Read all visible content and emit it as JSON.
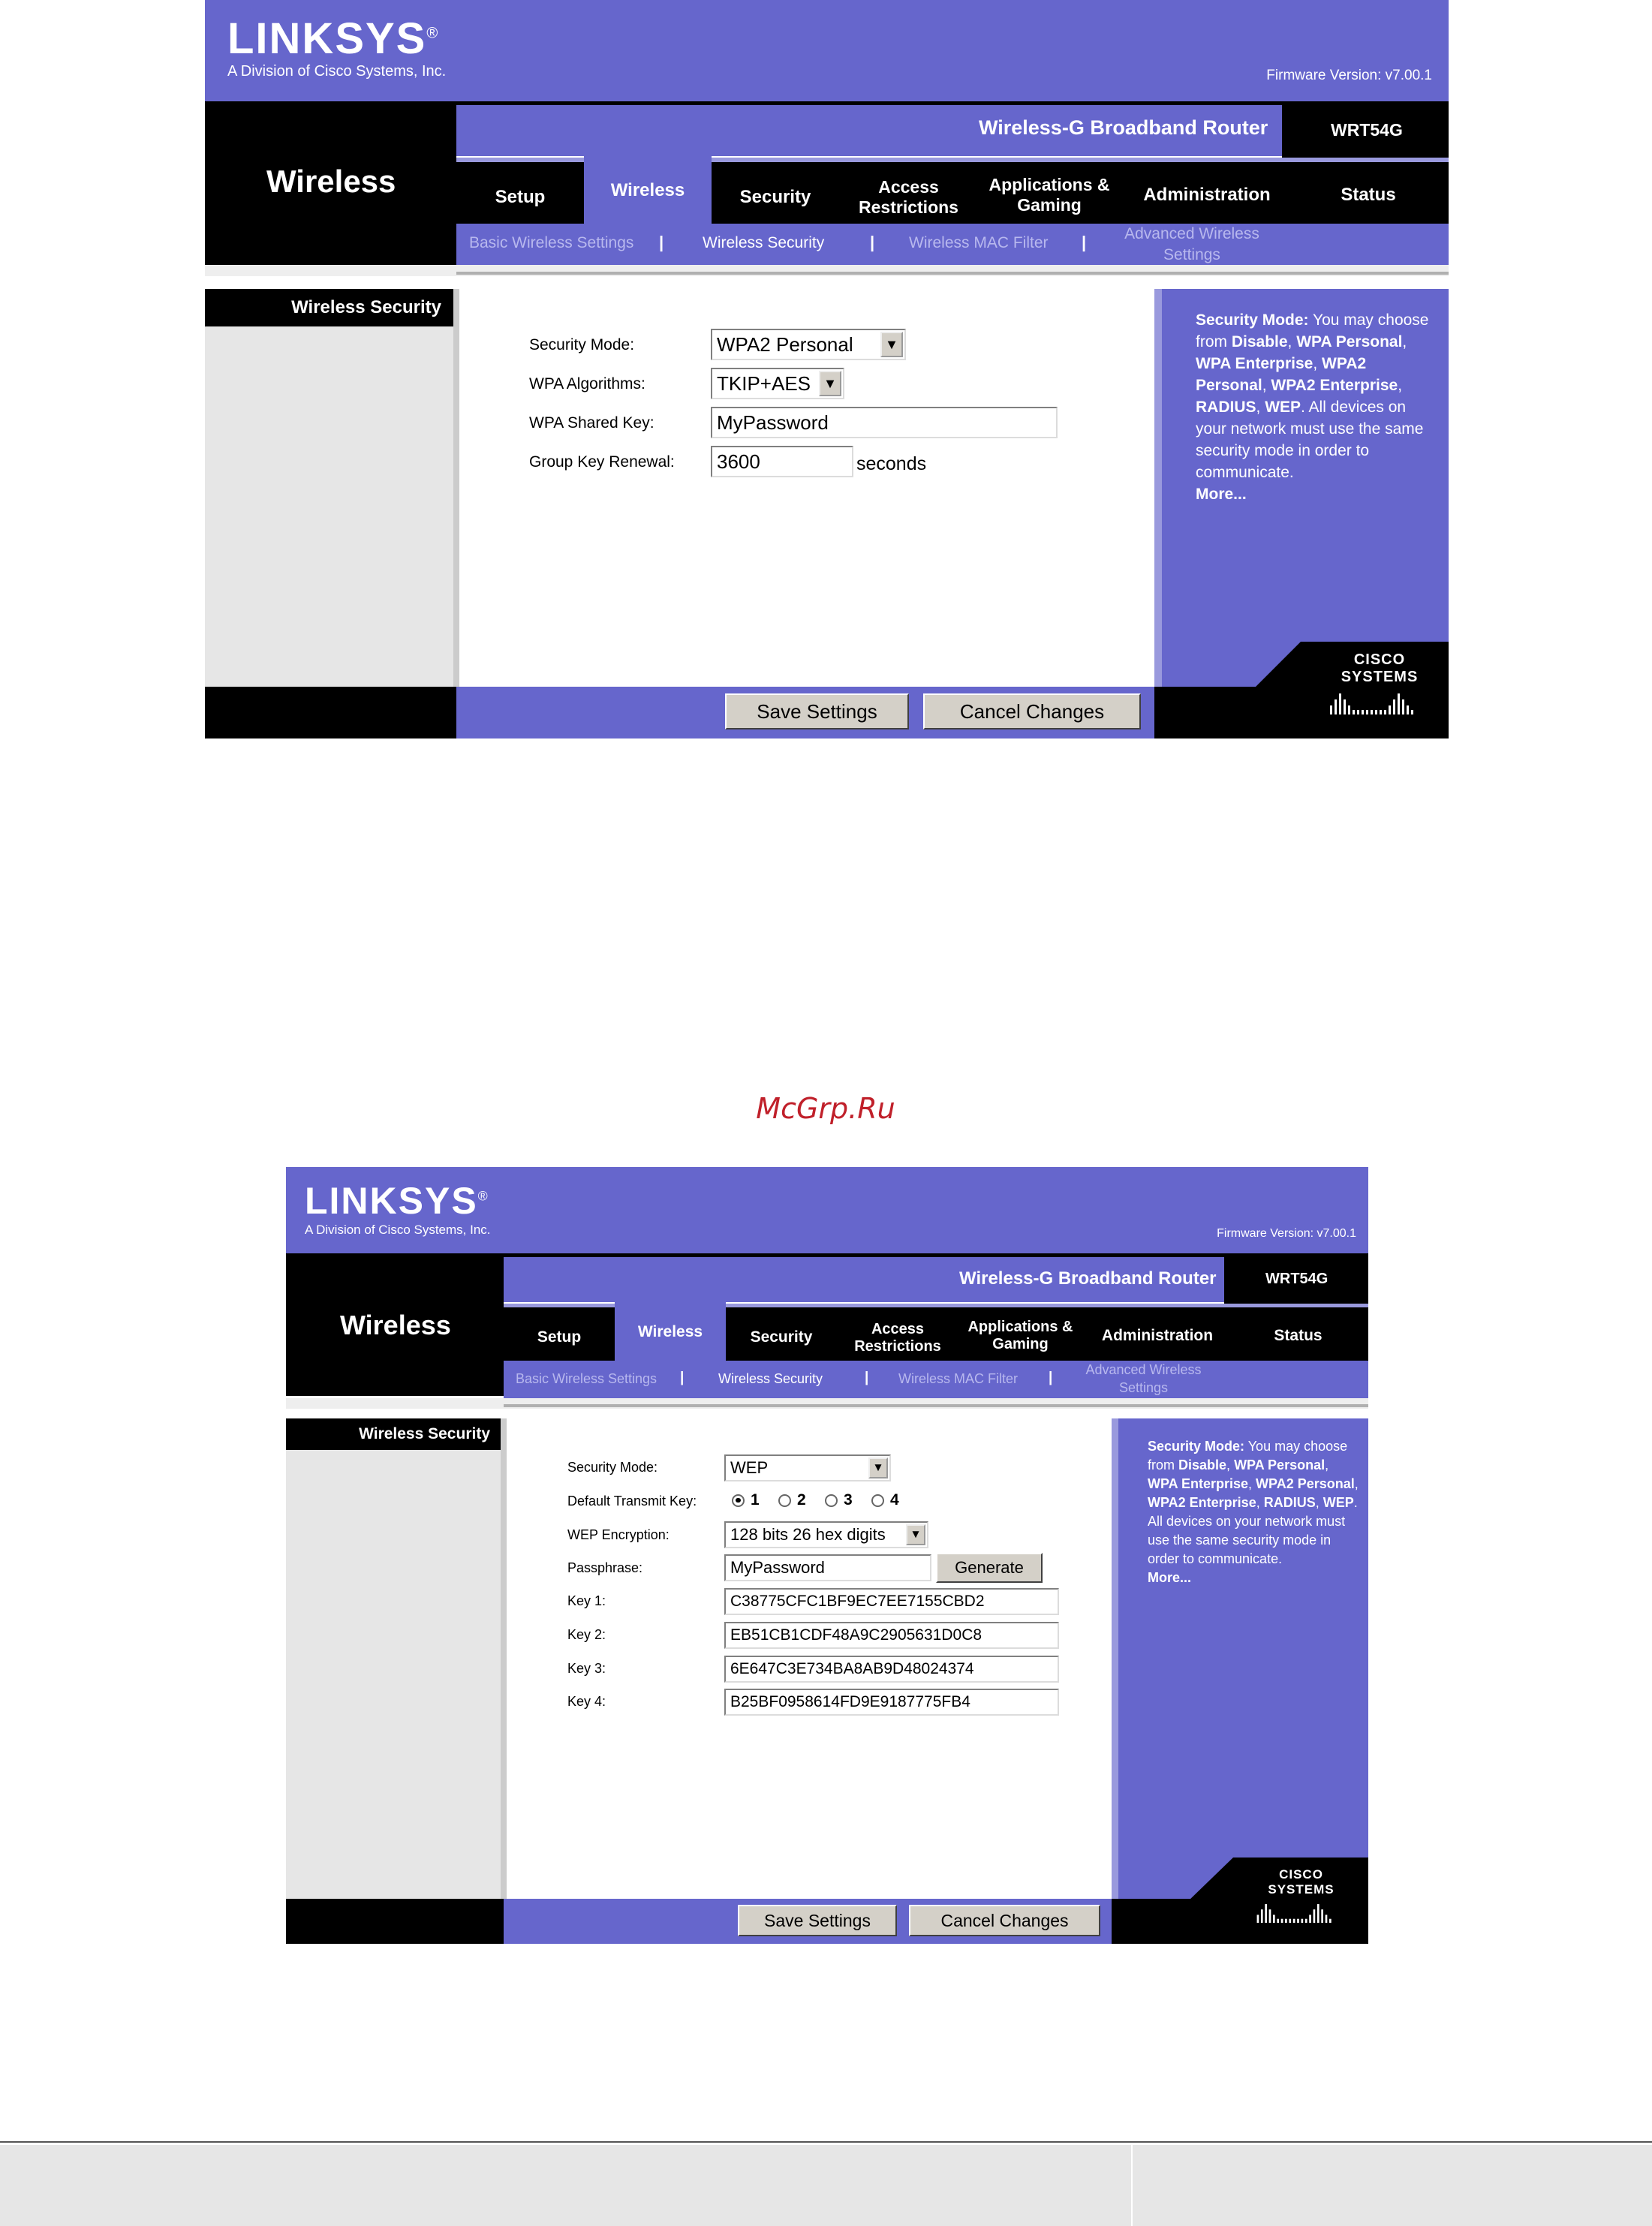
{
  "brand": {
    "logo": "LINKSYS",
    "logo_mark": "®",
    "division": "A Division of Cisco Systems, Inc.",
    "firmware": "Firmware Version: v7.00.1",
    "product": "Wireless-G Broadband Router",
    "model": "WRT54G",
    "section_title": "Wireless",
    "cisco": "CISCO SYSTEMS"
  },
  "tabs": [
    {
      "label": "Setup"
    },
    {
      "label": "Wireless"
    },
    {
      "label": "Security"
    },
    {
      "label": "Access Restrictions"
    },
    {
      "label": "Applications & Gaming"
    },
    {
      "label": "Administration"
    },
    {
      "label": "Status"
    }
  ],
  "subtabs": [
    {
      "label": "Basic Wireless Settings"
    },
    {
      "label": "Wireless Security"
    },
    {
      "label": "Wireless MAC Filter"
    },
    {
      "label": "Advanced Wireless Settings"
    }
  ],
  "subtab_separator": "|",
  "side_label": "Wireless Security",
  "screen1": {
    "security_mode_label": "Security Mode:",
    "security_mode_value": "WPA2 Personal",
    "wpa_alg_label": "WPA Algorithms:",
    "wpa_alg_value": "TKIP+AES",
    "shared_key_label": "WPA Shared  Key:",
    "shared_key_value": "MyPassword",
    "renewal_label": "Group Key  Renewal:",
    "renewal_value": "3600",
    "renewal_unit": "seconds"
  },
  "screen2": {
    "security_mode_label": "Security Mode:",
    "security_mode_value": "WEP",
    "default_key_label": "Default Transmit  Key:",
    "default_key_options": [
      "1",
      "2",
      "3",
      "4"
    ],
    "default_key_selected": "1",
    "wep_enc_label": "WEP Encryption:",
    "wep_enc_value": "128 bits 26 hex digits",
    "passphrase_label": "Passphrase:",
    "passphrase_value": "MyPassword",
    "generate_label": "Generate",
    "keys": [
      {
        "label": "Key 1:",
        "value": "C38775CFC1BF9EC7EE7155CBD2"
      },
      {
        "label": "Key 2:",
        "value": "EB51CB1CDF48A9C2905631D0C8"
      },
      {
        "label": "Key 3:",
        "value": "6E647C3E734BA8AB9D48024374"
      },
      {
        "label": "Key 4:",
        "value": "B25BF0958614FD9E9187775FB4"
      }
    ]
  },
  "help": {
    "lead": "Security Mode:",
    "t1": " You may choose from ",
    "b1": "Disable",
    "t2": ", ",
    "b2": "WPA Personal",
    "t3": ", ",
    "b3": "WPA Enterprise",
    "t4": ", ",
    "b4": "WPA2 Personal",
    "t5": ", ",
    "b5": "WPA2 Enterprise",
    "t6": ", ",
    "b6": "RADIUS",
    "t7": ", ",
    "b7": "WEP",
    "t8": ". All devices on your network must use the same security mode in order to communicate.",
    "more": "More..."
  },
  "buttons": {
    "save": "Save Settings",
    "cancel": "Cancel Changes"
  },
  "watermark": "McGrp.Ru",
  "colors": {
    "brand_purple": "#6666cc",
    "black": "#000000",
    "sidebar_gray": "#e6e6e6",
    "watermark_red": "#c0202a"
  }
}
